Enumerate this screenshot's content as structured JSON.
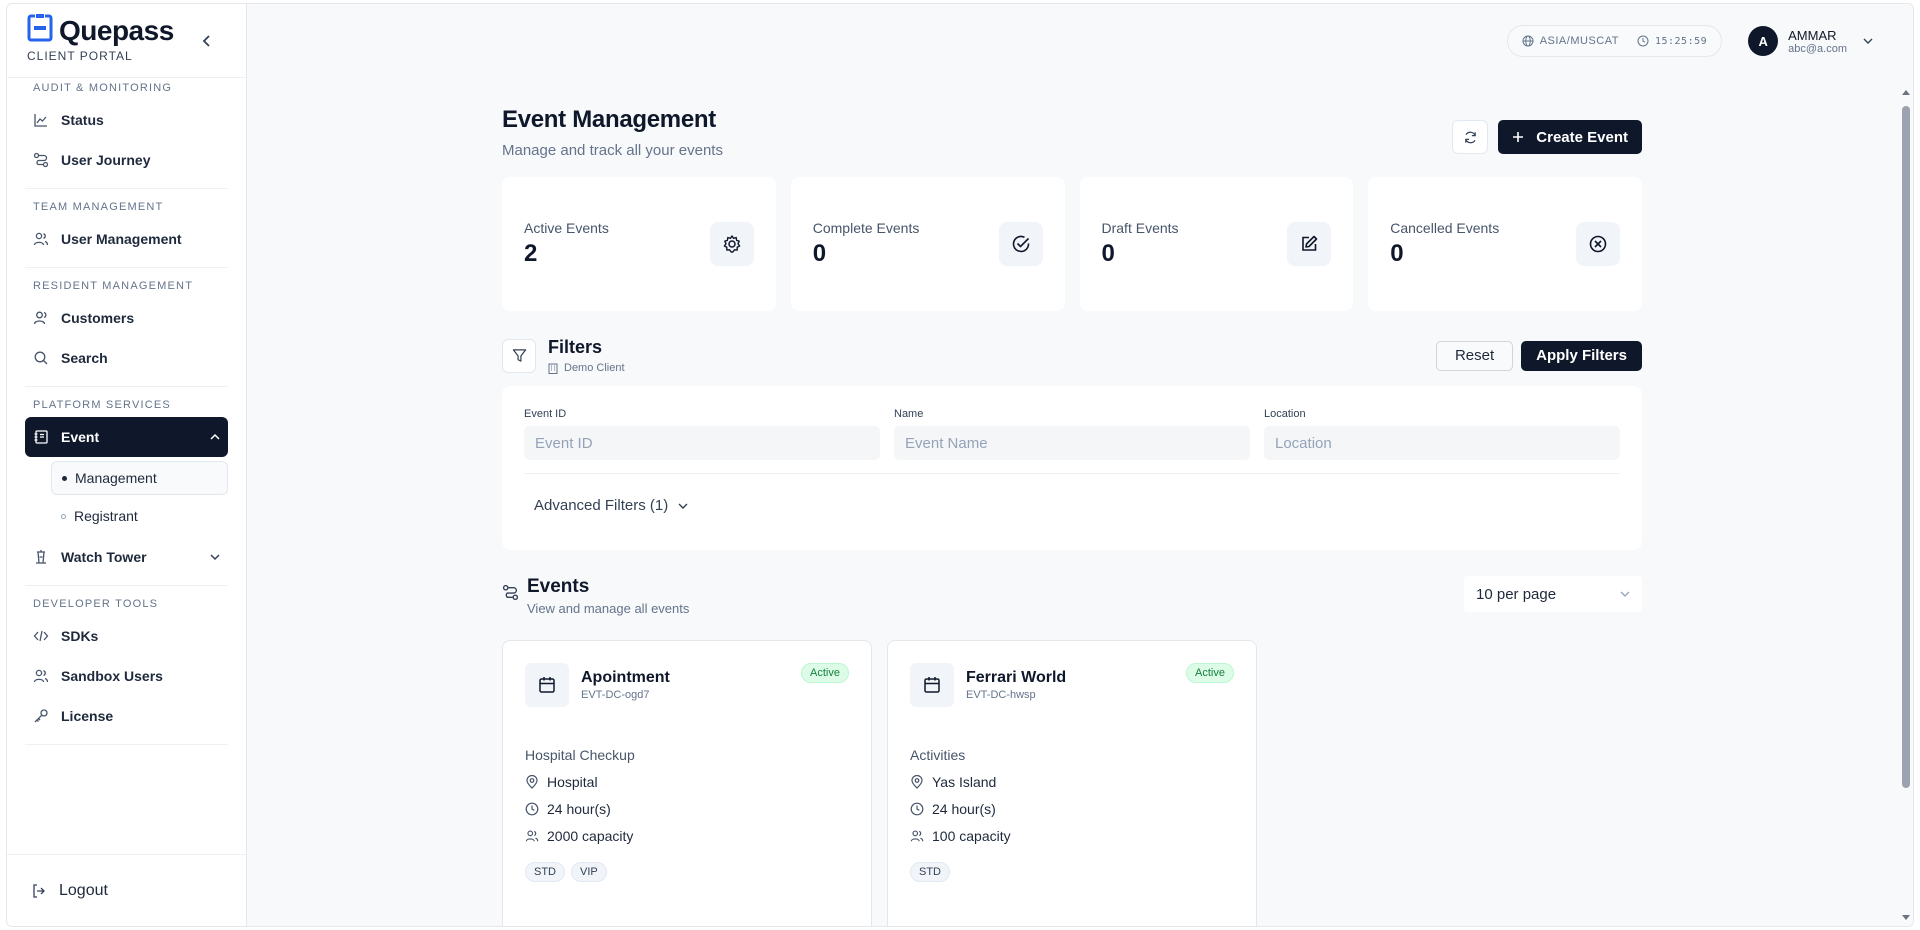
{
  "brand": {
    "name": "Quepass",
    "subtitle": "CLIENT PORTAL"
  },
  "sidebar": {
    "sections": [
      {
        "title": "AUDIT & MONITORING",
        "items": [
          "Status",
          "User Journey"
        ]
      },
      {
        "title": "TEAM MANAGEMENT",
        "items": [
          "User Management"
        ]
      },
      {
        "title": "RESIDENT MANAGEMENT",
        "items": [
          "Customers",
          "Search"
        ]
      },
      {
        "title": "PLATFORM SERVICES",
        "event": "Event",
        "sub_items": [
          "Management",
          "Registrant"
        ],
        "watch_tower": "Watch Tower"
      },
      {
        "title": "DEVELOPER TOOLS",
        "items": [
          "SDKs",
          "Sandbox Users",
          "License"
        ]
      }
    ],
    "logout": "Logout"
  },
  "topbar": {
    "timezone": "ASIA/MUSCAT",
    "time": "15:25:59",
    "user": {
      "initial": "A",
      "name": "AMMAR",
      "email": "abc@a.com"
    }
  },
  "page": {
    "title": "Event Management",
    "subtitle": "Manage and track all your events",
    "create_label": "Create Event"
  },
  "stats": [
    {
      "label": "Active Events",
      "value": "2"
    },
    {
      "label": "Complete Events",
      "value": "0"
    },
    {
      "label": "Draft Events",
      "value": "0"
    },
    {
      "label": "Cancelled Events",
      "value": "0"
    }
  ],
  "filters": {
    "title": "Filters",
    "client": "Demo Client",
    "reset": "Reset",
    "apply": "Apply Filters",
    "fields": [
      {
        "label": "Event ID",
        "placeholder": "Event ID",
        "value": ""
      },
      {
        "label": "Name",
        "placeholder": "Event Name",
        "value": ""
      },
      {
        "label": "Location",
        "placeholder": "Location",
        "value": ""
      }
    ],
    "advanced": "Advanced Filters (1)"
  },
  "events": {
    "title": "Events",
    "subtitle": "View and manage all events",
    "per_page": "10 per page",
    "items": [
      {
        "name": "Apointment",
        "id": "EVT-DC-ogd7",
        "status": "Active",
        "category": "Hospital Checkup",
        "location": "Hospital",
        "duration": "24 hour(s)",
        "capacity": "2000 capacity",
        "tags": [
          "STD",
          "VIP"
        ]
      },
      {
        "name": "Ferrari World",
        "id": "EVT-DC-hwsp",
        "status": "Active",
        "category": "Activities",
        "location": "Yas Island",
        "duration": "24 hour(s)",
        "capacity": "100 capacity",
        "tags": [
          "STD"
        ]
      }
    ]
  },
  "colors": {
    "primary": "#0f172a",
    "active_badge_bg": "#dcfce7",
    "active_badge_text": "#15803d",
    "brand_icon": "#2563eb"
  }
}
